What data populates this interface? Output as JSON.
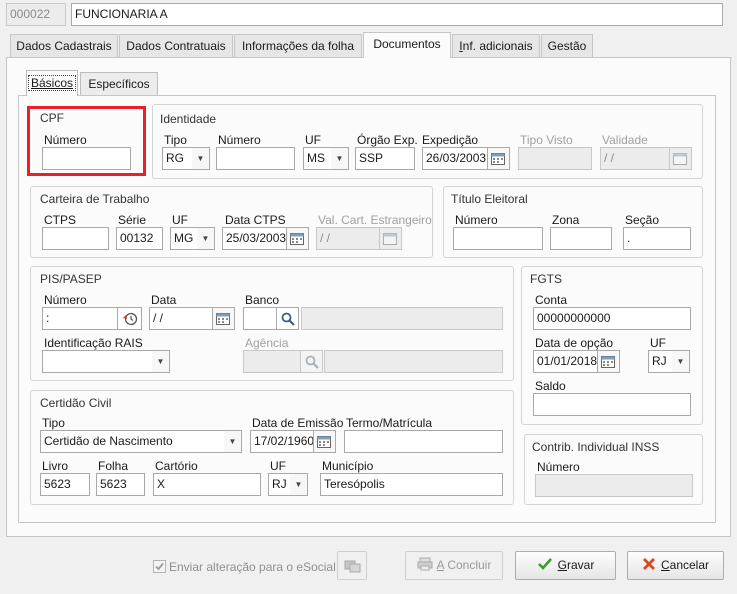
{
  "header": {
    "code": "000022",
    "name": "FUNCIONARIA A"
  },
  "tabs": [
    "Dados Cadastrais",
    "Dados Contratuais",
    "Informações da folha",
    "Documentos",
    "Inf. adicionais",
    "Gestão"
  ],
  "subtabs": [
    "Básicos",
    "Específicos"
  ],
  "cpf": {
    "title": "CPF",
    "numero_label": "Número",
    "numero": ""
  },
  "identidade": {
    "title": "Identidade",
    "tipo_label": "Tipo",
    "tipo": "RG",
    "numero_label": "Número",
    "numero": "",
    "uf_label": "UF",
    "uf": "MS",
    "orgao_label": "Órgão Exp.",
    "orgao": "SSP",
    "expedicao_label": "Expedição",
    "expedicao": "26/03/2003",
    "tipo_visto_label": "Tipo Visto",
    "tipo_visto": "",
    "validade_label": "Validade",
    "validade": " /  /"
  },
  "carteira": {
    "title": "Carteira de Trabalho",
    "ctps_label": "CTPS",
    "ctps": "",
    "serie_label": "Série",
    "serie": "00132",
    "uf_label": "UF",
    "uf": "MG",
    "data_label": "Data CTPS",
    "data": "25/03/2003",
    "val_label": "Val. Cart. Estrangeiro",
    "val": " /  /"
  },
  "titulo": {
    "title": "Título Eleitoral",
    "numero_label": "Número",
    "numero": "",
    "zona_label": "Zona",
    "zona": "",
    "secao_label": "Seção",
    "secao": "."
  },
  "pis": {
    "title": "PIS/PASEP",
    "numero_label": "Número",
    "numero": ":",
    "data_label": "Data",
    "data": " /  /",
    "banco_label": "Banco",
    "banco": "",
    "banco_nome": "",
    "rais_label": "Identificação RAIS",
    "rais": "",
    "agencia_label": "Agência",
    "agencia": "",
    "agencia_nome": ""
  },
  "fgts": {
    "title": "FGTS",
    "conta_label": "Conta",
    "conta": "00000000000",
    "opcao_label": "Data de opção",
    "opcao": "01/01/2018",
    "uf_label": "UF",
    "uf": "RJ",
    "saldo_label": "Saldo",
    "saldo": ""
  },
  "certidao": {
    "title": "Certidão Civil",
    "tipo_label": "Tipo",
    "tipo": "Certidão de Nascimento",
    "emissao_label": "Data de Emissão",
    "emissao": "17/02/1960",
    "termo_label": "Termo/Matrícula",
    "termo": "",
    "livro_label": "Livro",
    "livro": "5623",
    "folha_label": "Folha",
    "folha": "5623",
    "cartorio_label": "Cartório",
    "cartorio": "X",
    "uf_label": "UF",
    "uf": "RJ",
    "municipio_label": "Município",
    "municipio": "Teresópolis"
  },
  "inss": {
    "title": "Contrib. Individual INSS",
    "numero_label": "Número",
    "numero": ""
  },
  "footer": {
    "esocial_label": "Enviar alteração para o eSocial",
    "concluir_accel": "A",
    "concluir_rest": " Concluir",
    "gravar_accel": "G",
    "gravar_rest": "ravar",
    "cancelar_accel": "C",
    "cancelar_rest": "ancelar"
  },
  "colors": {
    "highlight": "#e8202a",
    "ok": "#3c9a2e",
    "cancel": "#d9481f"
  }
}
